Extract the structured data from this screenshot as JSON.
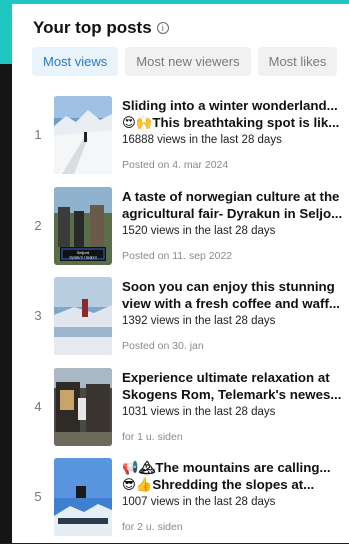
{
  "header": {
    "title": "Your top posts",
    "info_icon": "info-icon"
  },
  "tabs": [
    {
      "label": "Most views",
      "active": true
    },
    {
      "label": "Most new viewers",
      "active": false
    },
    {
      "label": "Most likes",
      "active": false
    }
  ],
  "posts": [
    {
      "rank": "1",
      "title_line1": "Sliding into a winter wonderland...",
      "title_line2": "😍🙌This breathtaking spot is lik...",
      "views": "16888 views in the last 28 days",
      "posted": "Posted on 4. mar 2024"
    },
    {
      "rank": "2",
      "title_line1": "A taste of norwegian culture at the",
      "title_line2": "agricultural fair- Dyrakun in Seljo...",
      "views": "1520 views in the last 28 days",
      "posted": "Posted on 11. sep 2022",
      "thumb_caption": "Seljord Dyrsku'n i Seljord"
    },
    {
      "rank": "3",
      "title_line1": "Soon you can enjoy this stunning",
      "title_line2": "view with a fresh coffee and waff...",
      "views": "1392 views in the last 28 days",
      "posted": "Posted on 30. jan"
    },
    {
      "rank": "4",
      "title_line1": "Experience ultimate relaxation at",
      "title_line2": "Skogens Rom, Telemark's newes...",
      "views": "1031 views in the last 28 days",
      "posted": "for 1 u. siden"
    },
    {
      "rank": "5",
      "title_line1": "📢🏔The mountains are calling...",
      "title_line2": "😎👍Shredding the slopes at...",
      "views": "1007 views in the last 28 days",
      "posted": "for 2 u. siden"
    }
  ]
}
